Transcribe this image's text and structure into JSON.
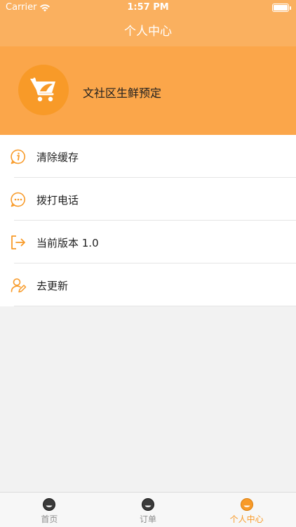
{
  "status_bar": {
    "carrier": "Carrier",
    "time": "1:57 PM"
  },
  "nav": {
    "title": "个人中心"
  },
  "profile": {
    "store_name": "文社区生鲜预定",
    "avatar_icon": "shopping-cart-icon"
  },
  "menu": {
    "items": [
      {
        "label": "清除缓存",
        "icon": "info-icon"
      },
      {
        "label": "拨打电话",
        "icon": "chat-dots-icon"
      },
      {
        "label": "当前版本 1.0",
        "icon": "logout-arrow-icon"
      },
      {
        "label": "去更新",
        "icon": "user-edit-icon"
      }
    ]
  },
  "tabbar": {
    "tabs": [
      {
        "label": "首页",
        "active": false
      },
      {
        "label": "订单",
        "active": false
      },
      {
        "label": "个人中心",
        "active": true
      }
    ]
  },
  "colors": {
    "nav_bg": "#fab05f",
    "profile_bg": "#fba64a",
    "accent": "#f89a28",
    "page_bg": "#f2f2f2"
  }
}
